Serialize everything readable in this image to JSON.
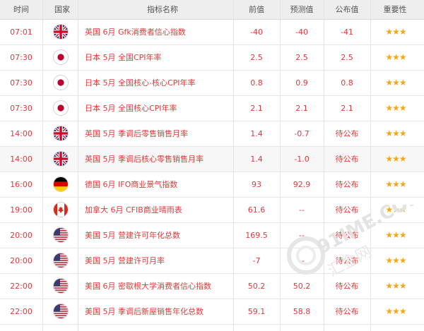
{
  "header": {
    "time": "时间",
    "country": "国家",
    "indicator": "指标名称",
    "previous": "前值",
    "forecast": "预测值",
    "actual": "公布值",
    "importance": "重要性"
  },
  "rows": [
    {
      "time": "07:01",
      "flag": "uk-flag-icon",
      "name": "英国 6月 Gfk消费者信心指数",
      "previous": "-40",
      "forecast": "-40",
      "actual": "-41",
      "stars": "★★★"
    },
    {
      "time": "07:30",
      "flag": "japan-flag-icon",
      "name": "日本 5月 全国CPI年率",
      "previous": "2.5",
      "forecast": "2.5",
      "actual": "2.5",
      "stars": "★★★"
    },
    {
      "time": "07:30",
      "flag": "japan-flag-icon",
      "name": "日本 5月 全国核心-核心CPI年率",
      "previous": "0.8",
      "forecast": "0.9",
      "actual": "0.8",
      "stars": "★★★"
    },
    {
      "time": "07:30",
      "flag": "japan-flag-icon",
      "name": "日本 5月 全国核心CPI年率",
      "previous": "2.1",
      "forecast": "2.1",
      "actual": "2.1",
      "stars": "★★★"
    },
    {
      "time": "14:00",
      "flag": "uk-flag-icon",
      "name": "英国 5月 季调后零售销售月率",
      "previous": "1.4",
      "forecast": "-0.7",
      "actual": "待公布",
      "stars": "★★★"
    },
    {
      "time": "14:00",
      "flag": "uk-flag-icon",
      "name": "英国 5月 季调后核心零售销售月率",
      "previous": "1.4",
      "forecast": "-1.0",
      "actual": "待公布",
      "stars": "★★★"
    },
    {
      "time": "16:00",
      "flag": "germany-flag-icon",
      "name": "德国 6月 IFO商业景气指数",
      "previous": "93",
      "forecast": "92.9",
      "actual": "待公布",
      "stars": "★★★"
    },
    {
      "time": "19:00",
      "flag": "canada-flag-icon",
      "name": "加拿大 6月 CFIB商业晴雨表",
      "previous": "61.6",
      "forecast": "--",
      "actual": "待公布",
      "stars": "★★★"
    },
    {
      "time": "20:00",
      "flag": "usa-flag-icon",
      "name": "美国 5月 营建许可年化总数",
      "previous": "169.5",
      "forecast": "--",
      "actual": "待公布",
      "stars": "★★★"
    },
    {
      "time": "20:00",
      "flag": "usa-flag-icon",
      "name": "美国 5月 营建许可月率",
      "previous": "-7",
      "forecast": "--",
      "actual": "待公布",
      "stars": "★★★"
    },
    {
      "time": "22:00",
      "flag": "usa-flag-icon",
      "name": "美国 6月 密歇根大学消费者信心指数",
      "previous": "50.2",
      "forecast": "50.2",
      "actual": "待公布",
      "stars": "★★★"
    },
    {
      "time": "22:00",
      "flag": "usa-flag-icon",
      "name": "美国 5月 季调后新屋销售年化总数",
      "previous": "59.1",
      "forecast": "58.8",
      "actual": "待公布",
      "stars": "★★★"
    }
  ],
  "watermark": {
    "text": "91IME.COM",
    "subtext": "汇金网"
  },
  "colors": {
    "value_red": "#e03a3a",
    "star_gold": "#f2a81b",
    "header_bg": "#eeeeee",
    "alt_row_bg": "#f7f7f7"
  }
}
